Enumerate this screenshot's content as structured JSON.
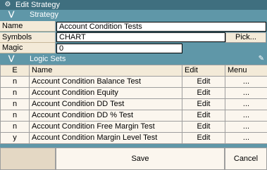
{
  "window": {
    "title": "Edit Strategy",
    "icon": "gear-icon"
  },
  "strategy_section": {
    "title": "Strategy",
    "chevron_icon": "chevron-down-icon"
  },
  "fields": {
    "name_label": "Name",
    "name_value": "Account Condition Tests",
    "symbols_label": "Symbols",
    "symbols_value": "CHART",
    "pick_label": "Pick...",
    "magic_label": "Magic",
    "magic_value": "0"
  },
  "logic_sets": {
    "title": "Logic Sets",
    "edit_icon": "pencil-icon",
    "columns": {
      "e": "E",
      "name": "Name",
      "edit": "Edit",
      "menu": "Menu"
    },
    "rows": [
      {
        "e": "n",
        "name": "Account Condition Balance Test",
        "edit": "Edit",
        "menu": "..."
      },
      {
        "e": "n",
        "name": "Account Condition Equity",
        "edit": "Edit",
        "menu": "..."
      },
      {
        "e": "n",
        "name": "Account Condition DD Test",
        "edit": "Edit",
        "menu": "..."
      },
      {
        "e": "n",
        "name": "Account Condition DD % Test",
        "edit": "Edit",
        "menu": "..."
      },
      {
        "e": "n",
        "name": "Account Condition Free Margin Test",
        "edit": "Edit",
        "menu": "..."
      },
      {
        "e": "y",
        "name": "Account Condition Margin Level Test",
        "edit": "Edit",
        "menu": "..."
      }
    ]
  },
  "footer": {
    "save_label": "Save",
    "cancel_label": "Cancel"
  },
  "colors": {
    "header_teal": "#5f97a8",
    "title_bar": "#3f6f7f",
    "label_bg": "#f3ead8",
    "cell_bg": "#fbf6ee"
  }
}
